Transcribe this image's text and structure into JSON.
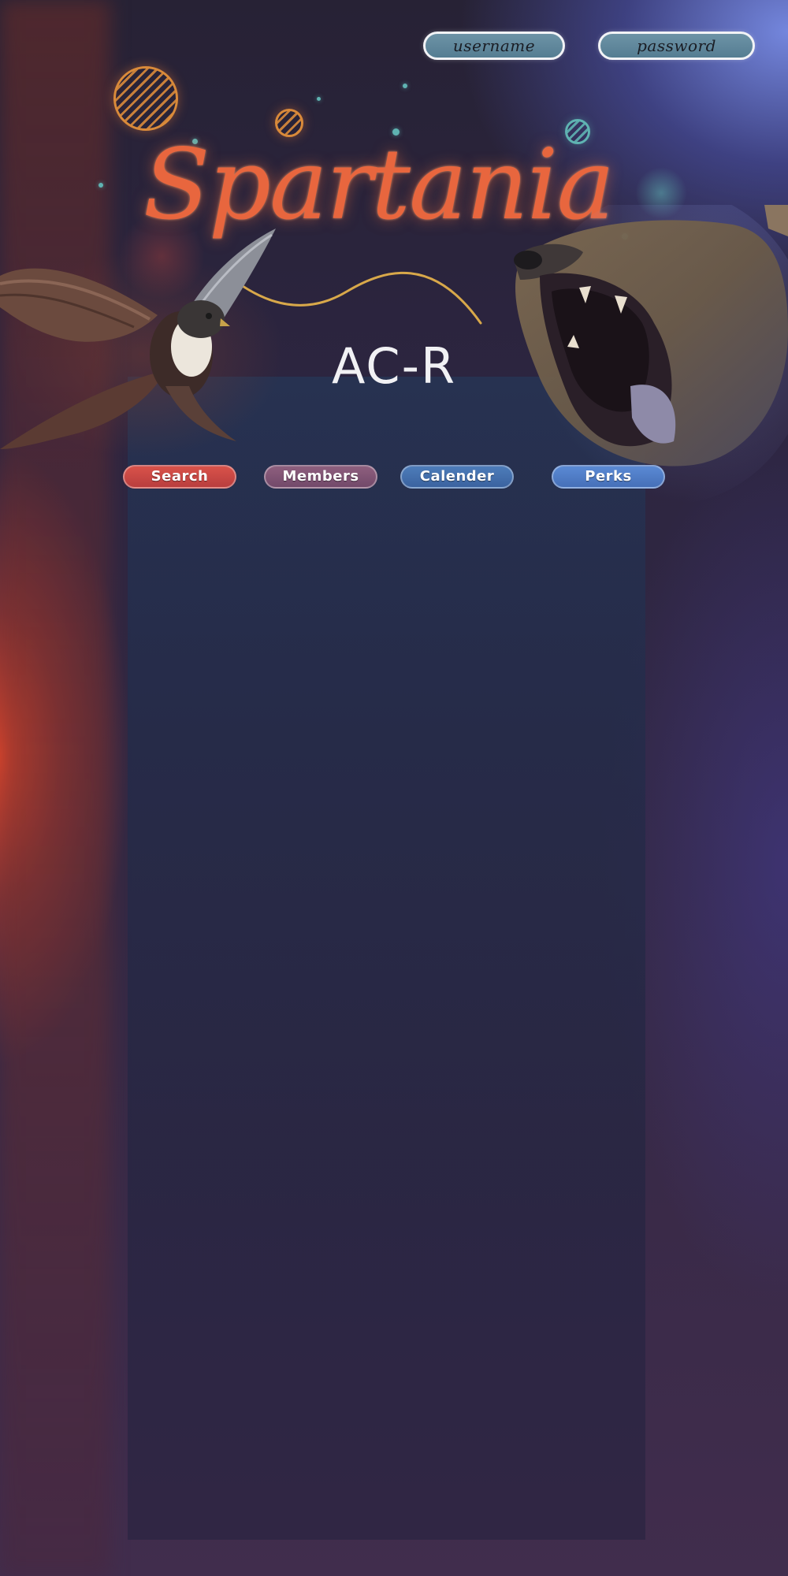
{
  "login": {
    "username_placeholder": "username",
    "password_placeholder": "password"
  },
  "header": {
    "title": "Spartania",
    "subtitle": "AC-R"
  },
  "nav": {
    "items": [
      {
        "label": "Search"
      },
      {
        "label": "Members"
      },
      {
        "label": "Calender"
      },
      {
        "label": "Perks"
      }
    ]
  },
  "colors": {
    "accent_orange": "#e8663e",
    "search_button": "#d9524a",
    "members_button": "#8e5f7e",
    "calendar_button": "#4d7cba",
    "perks_button": "#5a8ad4",
    "teal_accent": "#5fb3b2",
    "panel": "#263454"
  },
  "icons": {
    "left_illustration": "falcon",
    "right_illustration": "bear"
  }
}
